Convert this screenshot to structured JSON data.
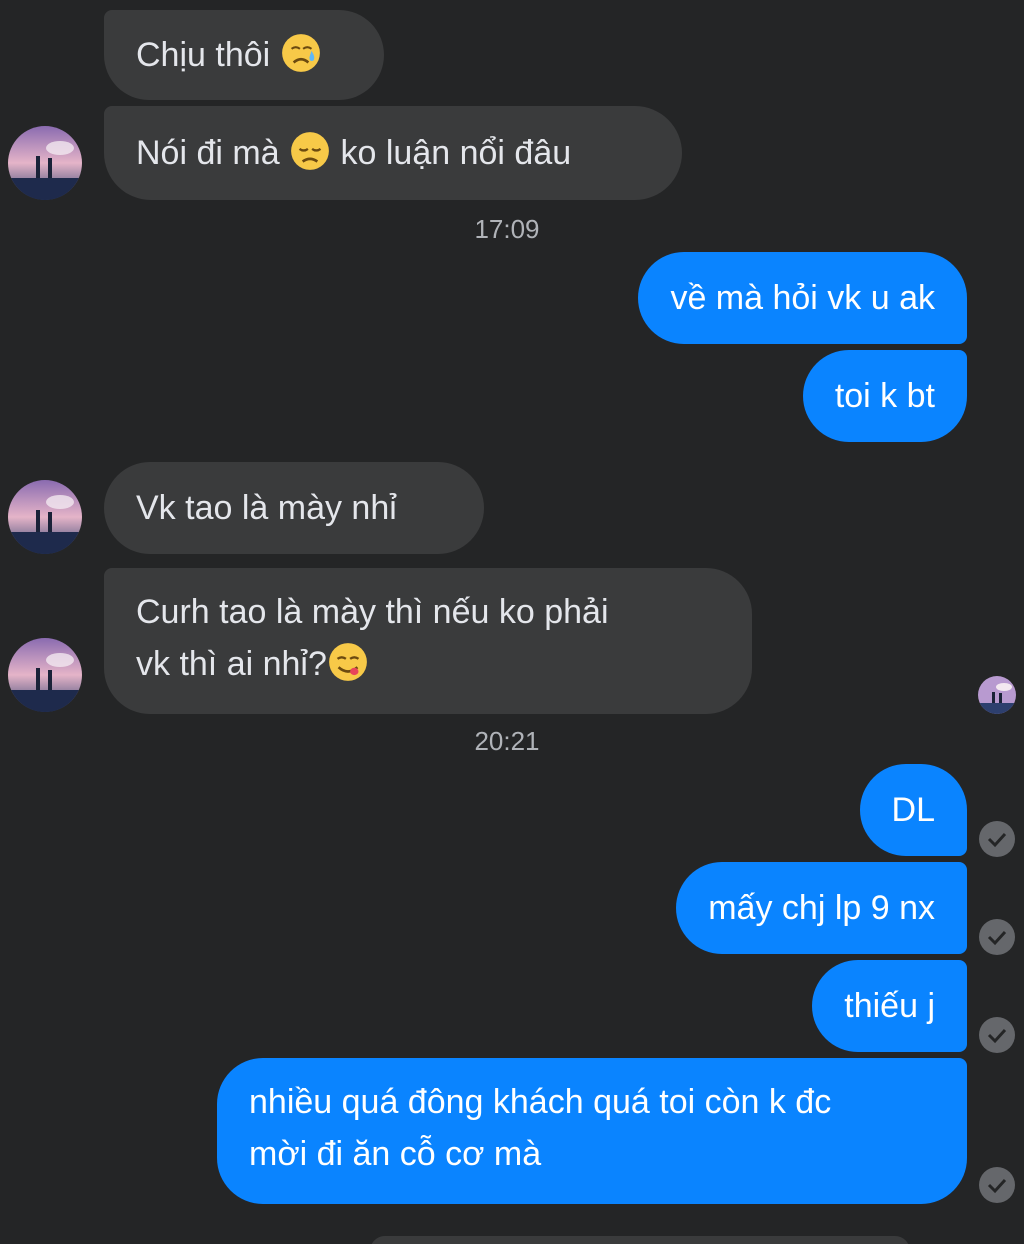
{
  "conversation": {
    "messages": {
      "m0": "Chịu thôi",
      "m1": "Nói đi mà",
      "m1b": "ko luận nổi đâu",
      "t1": "17:09",
      "m2": "về mà hỏi vk u ak",
      "m3": "toi k bt",
      "m4": "Vk tao  là mày nhỉ",
      "m5a": "Curh tao là mày thì nếu ko phải",
      "m5b": "vk thì ai nhỉ?",
      "t2": "20:21",
      "m6": "DL",
      "m7": "mấy chj lp 9 nx",
      "m8": "thiếu j",
      "m9a": "nhiều quá đông khách quá toi còn k đc",
      "m9b": "mời đi ăn cỗ cơ mà"
    },
    "emoji": {
      "m0": "sad-but-relieved-face",
      "m1": "disappointed-face",
      "m5": "face-savoring-food"
    }
  },
  "theme": {
    "background": "#242526",
    "incoming_bubble": "#3a3b3c",
    "outgoing_bubble": "#0a84ff",
    "text": "#e4e6eb",
    "timestamp": "#b0b3b8"
  }
}
